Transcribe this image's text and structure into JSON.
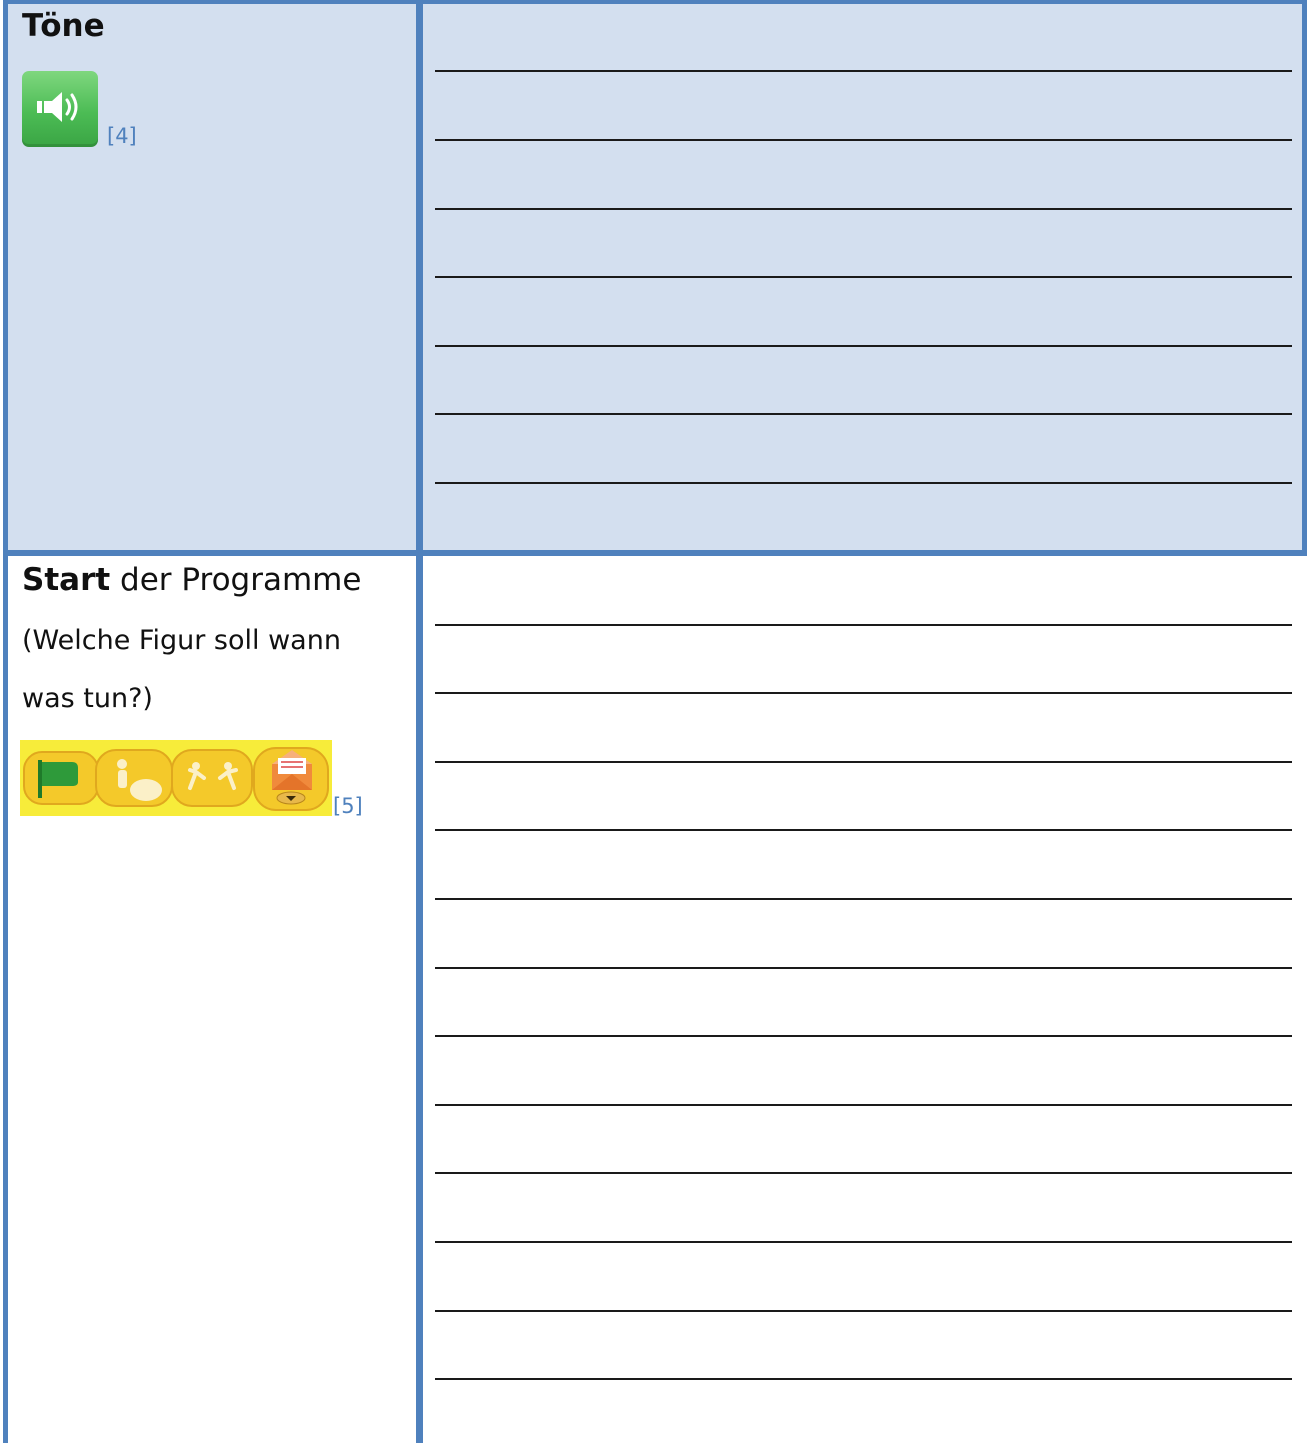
{
  "rows": [
    {
      "title_bold": "Töne",
      "title_rest": "",
      "subtitle_lines": [],
      "icon": "sound-speaker-icon",
      "ref": "[4]",
      "write_line_count": 7
    },
    {
      "title_bold": "Start",
      "title_rest": " der Programme",
      "subtitle_lines": [
        "(Welche Figur soll wann",
        "was tun?)"
      ],
      "icons": [
        "green-flag-icon",
        "tap-character-icon",
        "bump-characters-icon",
        "message-envelope-icon"
      ],
      "ref": "[5]",
      "write_line_count": 12
    }
  ],
  "colors": {
    "border": "#4f81bd",
    "row1_background": "#d3dfef",
    "reference_text": "#4f81bd",
    "trigger_yellow": "#f7ec3a",
    "sound_green": "#4cbc55"
  }
}
